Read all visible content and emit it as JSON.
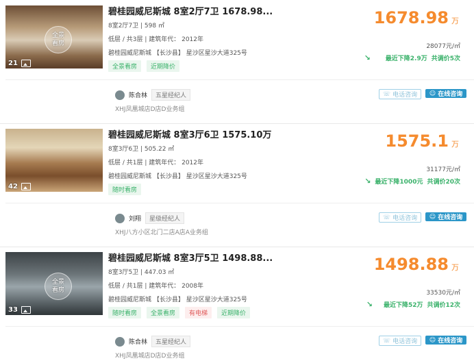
{
  "listings": [
    {
      "photo_count": "21",
      "vr_label": "全景\n看房",
      "title": "碧桂园威尼斯城 8室2厅7卫 1678.98...",
      "layout_area": "8室2厅7卫 | 598 ㎡",
      "floor_year": "低层 / 共3层 | 建筑年代： 2012年",
      "address": "碧桂园威尼斯城 【长沙县】 星沙区星沙大道325号",
      "tags": [
        {
          "label": "全景看房",
          "color": "green"
        },
        {
          "label": "近期降价",
          "color": "green"
        }
      ],
      "price": "1678.98",
      "price_unit": "万",
      "unit_price": "28077元/㎡",
      "trend_drop": "最近下降2.9万",
      "trend_count": "共调价5次",
      "agent_name": "陈合林",
      "agent_level": "五星经纪人",
      "store": "XHJ凤凰城店D店D业务组",
      "phone_btn": "电话咨询",
      "chat_btn": "在线咨询"
    },
    {
      "photo_count": "42",
      "vr_label": "",
      "title": "碧桂园威尼斯城 8室3厅6卫 1575.10万",
      "layout_area": "8室3厅6卫 | 505.22 ㎡",
      "floor_year": "低层 / 共1层 | 建筑年代： 2012年",
      "address": "碧桂园威尼斯城 【长沙县】 星沙区星沙大道325号",
      "tags": [
        {
          "label": "随时看房",
          "color": "green"
        }
      ],
      "price": "1575.1",
      "price_unit": "万",
      "unit_price": "31177元/㎡",
      "trend_drop": "最近下降1000元",
      "trend_count": "共调价20次",
      "agent_name": "刘翔",
      "agent_level": "星级经纪人",
      "store": "XHJ八方小区北门二店A店A业务组",
      "phone_btn": "电话咨询",
      "chat_btn": "在线咨询"
    },
    {
      "photo_count": "33",
      "vr_label": "全景\n看房",
      "title": "碧桂园威尼斯城 8室3厅5卫 1498.88...",
      "layout_area": "8室3厅5卫 | 447.03 ㎡",
      "floor_year": "低层 / 共1层 | 建筑年代： 2008年",
      "address": "碧桂园威尼斯城 【长沙县】 星沙区星沙大道325号",
      "tags": [
        {
          "label": "随时看房",
          "color": "green"
        },
        {
          "label": "全景看房",
          "color": "green"
        },
        {
          "label": "有电梯",
          "color": "red"
        },
        {
          "label": "近期降价",
          "color": "green"
        }
      ],
      "price": "1498.88",
      "price_unit": "万",
      "unit_price": "33530元/㎡",
      "trend_drop": "最近下降52万",
      "trend_count": "共调价12次",
      "agent_name": "陈合林",
      "agent_level": "五星经纪人",
      "store": "XHJ凤凰城店D店D业务组",
      "phone_btn": "电话咨询",
      "chat_btn": "在线咨询"
    }
  ]
}
